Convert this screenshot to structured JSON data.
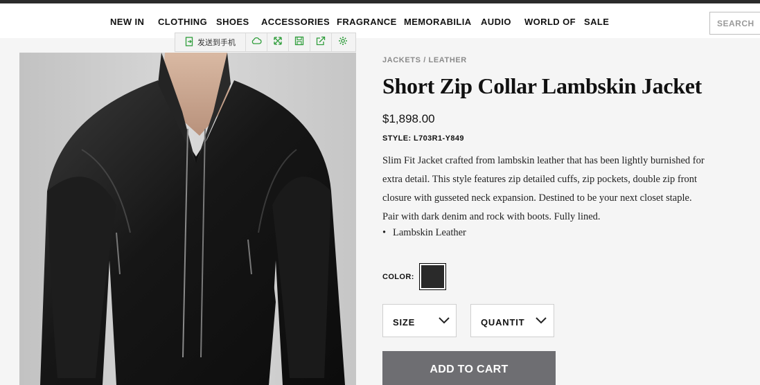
{
  "nav": {
    "items": [
      "NEW IN",
      "CLOTHING",
      "SHOES",
      "ACCESSORIES",
      "FRAGRANCE",
      "MEMORABILIA",
      "AUDIO",
      "WORLD OF",
      "SALE"
    ],
    "search_placeholder": "SEARCH"
  },
  "toolbar": {
    "send_label": "发送到手机",
    "icons": [
      "send-to-phone-icon",
      "cloud-icon",
      "expand-icon",
      "save-icon",
      "share-icon",
      "settings-icon"
    ],
    "accent": "#2e9d3a"
  },
  "product": {
    "breadcrumb": [
      "JACKETS",
      "LEATHER"
    ],
    "breadcrumb_separator": "/",
    "title": "Short Zip Collar Lambskin Jacket",
    "price": "$1,898.00",
    "style_label": "STYLE:",
    "style_code": "L703R1-Y849",
    "description": "Slim Fit Jacket crafted from lambskin leather that has been lightly burnished for extra detail. This style features zip detailed cuffs, zip pockets, double zip front closure with gusseted neck expansion. Destined to be your next closet staple. Pair with dark denim and rock with boots. Fully lined.",
    "bullets": [
      "Lambskin Leather"
    ],
    "color_label": "COLOR:",
    "color_swatch": "#2a2a2a",
    "size_label": "SIZE",
    "quantity_label": "QUANTITY",
    "add_to_cart": "ADD TO CART",
    "cart_button_color": "#6e6e72"
  }
}
